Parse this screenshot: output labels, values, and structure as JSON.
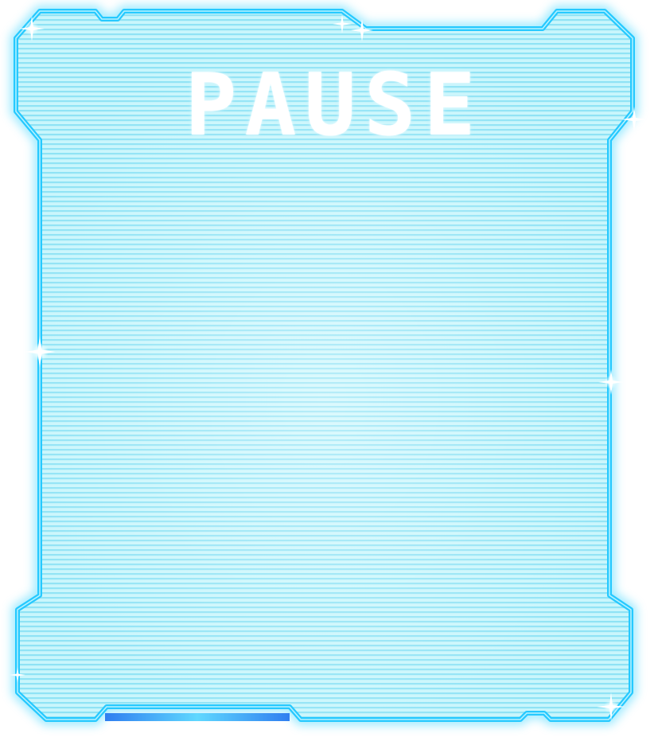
{
  "pause_menu": {
    "title": "PAUSE"
  },
  "colors": {
    "panel_fill": "#bff3fb",
    "scanline": "#8fe6f7",
    "border_glow": "#3fd3ff",
    "border_core": "#22c7ff",
    "side_edge": "#1f5be6",
    "bottom_bar": "#2f8cf0",
    "title_text": "#ffffff"
  },
  "icons": {
    "sparkle": "sparkle-icon"
  }
}
